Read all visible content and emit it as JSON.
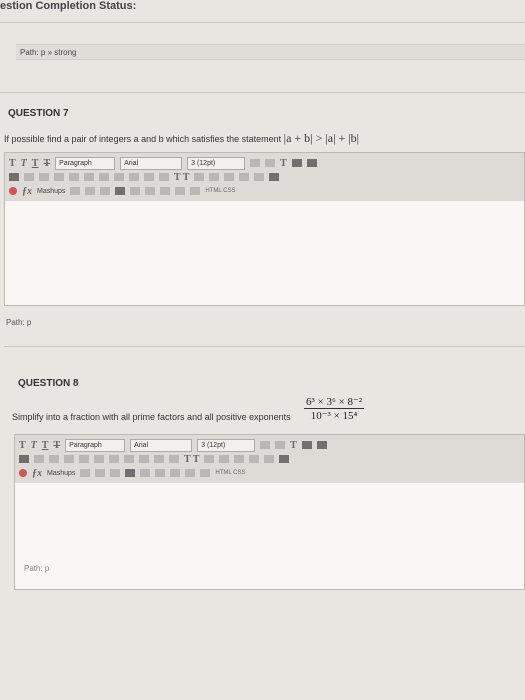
{
  "header": {
    "completion_status": "estion Completion Status:"
  },
  "q7": {
    "path_label": "Path: p » strong",
    "title": "QUESTION 7",
    "prompt": "If possible find a pair of integers a and b which satisfies the statement",
    "statement": "|a + b| > |a| + |b|",
    "editor_path": "Path: p"
  },
  "q8": {
    "title": "QUESTION 8",
    "prompt": "Simplify into a fraction with all prime factors and all positive exponents",
    "numerator": "6³ × 3⁶ × 8⁻²",
    "denominator": "10⁻³ × 15⁴",
    "editor_path": "Path: p"
  },
  "toolbar": {
    "text_buttons": [
      "T",
      "T",
      "T",
      "T"
    ],
    "format_select": "Paragraph",
    "font_select": "Arial",
    "size_select": "3 (12pt)",
    "mashups": "Mashups",
    "super_sub": "T T",
    "html_css": "HTML CSS"
  }
}
